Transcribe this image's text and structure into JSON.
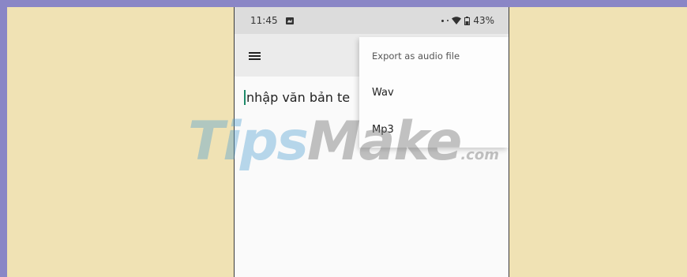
{
  "status_bar": {
    "time": "11:45",
    "battery": "43%"
  },
  "dropdown": {
    "header": "Export as audio file",
    "items": [
      {
        "label": "Wav"
      },
      {
        "label": "Mp3"
      }
    ]
  },
  "editor": {
    "text": "nhập văn bản te"
  },
  "watermark": {
    "part1": "Tips",
    "part2": "Make",
    "part3": ".com"
  },
  "colors": {
    "frame": "#8a86c6",
    "background": "#f0e2b4",
    "status_bar": "#dcdcdc",
    "app_bar": "#ebebeb",
    "cursor": "#1e8a6a"
  }
}
